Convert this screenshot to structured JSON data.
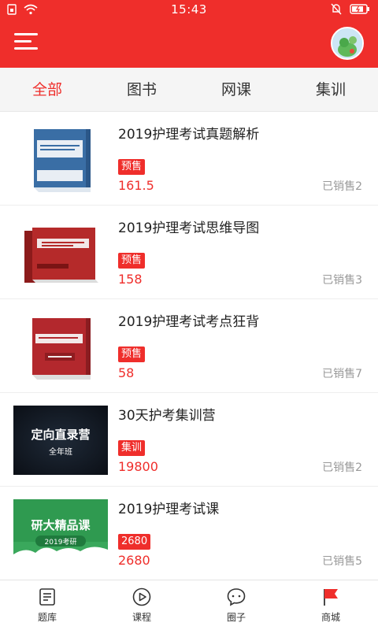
{
  "status_bar": {
    "time": "15:43"
  },
  "tabs": [
    {
      "label": "全部",
      "active": true
    },
    {
      "label": "图书",
      "active": false
    },
    {
      "label": "网课",
      "active": false
    },
    {
      "label": "集训",
      "active": false
    }
  ],
  "items": [
    {
      "title": "2019护理考试真题解析",
      "badge": "预售",
      "price": "161.5",
      "sold": "已销售2",
      "thumb": "book-blue"
    },
    {
      "title": "2019护理考试思维导图",
      "badge": "预售",
      "price": "158",
      "sold": "已销售3",
      "thumb": "book-red"
    },
    {
      "title": "2019护理考试考点狂背",
      "badge": "预售",
      "price": "58",
      "sold": "已销售7",
      "thumb": "book-red"
    },
    {
      "title": "30天护考集训营",
      "badge": "集训",
      "price": "19800",
      "sold": "已销售2",
      "thumb": "banner-dark",
      "thumb_text_1": "定向直录营",
      "thumb_text_2": "全年班"
    },
    {
      "title": "2019护理考试课",
      "badge": "2680",
      "price": "2680",
      "sold": "已销售5",
      "thumb": "banner-green",
      "thumb_text_1": "研大精品课",
      "thumb_text_2": "2019考研"
    }
  ],
  "bottom_nav": [
    {
      "label": "题库",
      "icon": "question-bank-icon",
      "active": false
    },
    {
      "label": "课程",
      "icon": "play-circle-icon",
      "active": false
    },
    {
      "label": "圈子",
      "icon": "chat-bubble-icon",
      "active": false
    },
    {
      "label": "商城",
      "icon": "flag-icon",
      "active": true
    }
  ],
  "colors": {
    "accent": "#ef2e2b",
    "text": "#222222",
    "muted": "#999999"
  }
}
